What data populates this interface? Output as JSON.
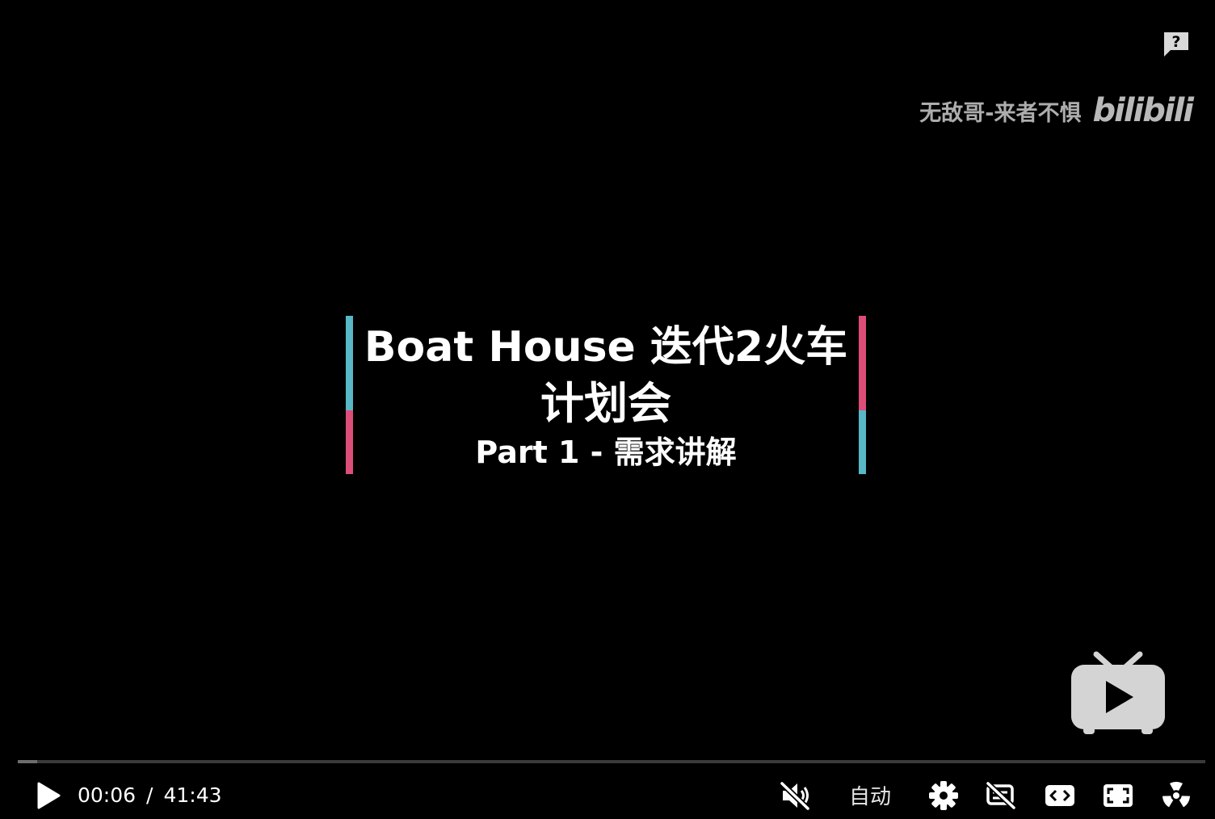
{
  "video": {
    "watermark": {
      "author": "无敌哥-来者不惧",
      "logo": "bilibili"
    },
    "title_card": {
      "line1": "Boat House 迭代2火车",
      "line2": "计划会",
      "line3": "Part 1 - 需求讲解",
      "accent_colors": {
        "cyan": "#58b8c6",
        "pink": "#dc4d77"
      }
    },
    "feedback_icon": "feedback-question-icon",
    "center_icon": "tv-play-icon"
  },
  "player": {
    "progress": 0.0024,
    "current_time": "00:06",
    "separator": "/",
    "duration": "41:43",
    "quality_label": "自动",
    "icons": {
      "play": "play-icon",
      "mute": "muted-speaker-icon",
      "settings": "gear-icon",
      "danmaku": "danmaku-off-icon",
      "widescreen": "widescreen-icon",
      "fullscreen": "fullscreen-icon",
      "extra": "radiation-icon"
    }
  }
}
